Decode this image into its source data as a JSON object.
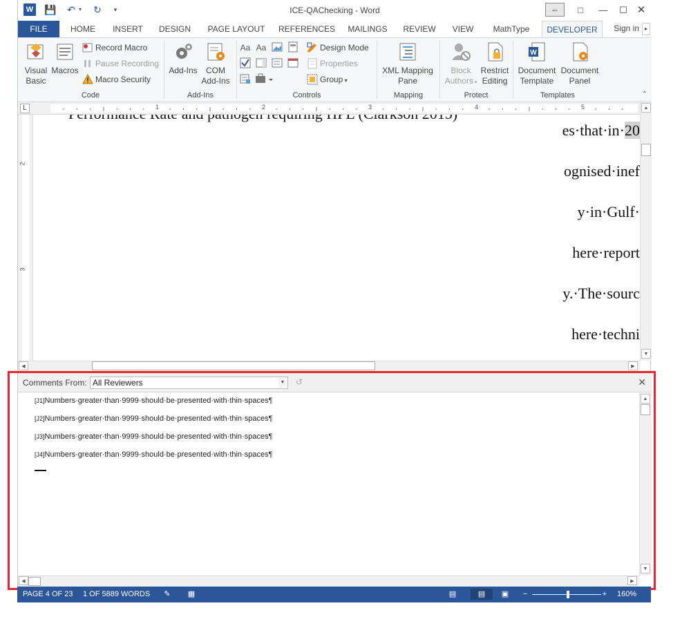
{
  "window": {
    "title": "ICE-QAChecking - Word",
    "qat": {
      "app_icon": "W"
    }
  },
  "tabs": [
    {
      "label": "FILE"
    },
    {
      "label": "HOME"
    },
    {
      "label": "INSERT"
    },
    {
      "label": "DESIGN"
    },
    {
      "label": "PAGE LAYOUT"
    },
    {
      "label": "REFERENCES"
    },
    {
      "label": "MAILINGS"
    },
    {
      "label": "REVIEW"
    },
    {
      "label": "VIEW"
    },
    {
      "label": "MathType"
    },
    {
      "label": "DEVELOPER"
    }
  ],
  "signin": "Sign in",
  "ribbon": {
    "code": {
      "label": "Code",
      "visual_basic_1": "Visual",
      "visual_basic_2": "Basic",
      "macros": "Macros",
      "record_macro": "Record Macro",
      "pause_recording": "Pause Recording",
      "macro_security": "Macro Security"
    },
    "addins": {
      "label": "Add-Ins",
      "addins": "Add-Ins",
      "com_1": "COM",
      "com_2": "Add-Ins"
    },
    "controls": {
      "label": "Controls",
      "design_mode": "Design Mode",
      "properties": "Properties",
      "group": "Group"
    },
    "mapping": {
      "label": "Mapping",
      "xml_1": "XML Mapping",
      "xml_2": "Pane"
    },
    "protect": {
      "label": "Protect",
      "block_1": "Block",
      "block_2": "Authors",
      "restrict_1": "Restrict",
      "restrict_2": "Editing"
    },
    "templates": {
      "label": "Templates",
      "doc_template_1": "Document",
      "doc_template_2": "Template",
      "doc_panel_1": "Document",
      "doc_panel_2": "Panel"
    }
  },
  "ruler": {
    "h_numbers": [
      "1",
      "2",
      "3",
      "4",
      "5"
    ],
    "v_numbers": [
      "2",
      "3"
    ],
    "tab_selector": "L"
  },
  "document": {
    "lines": [
      "es·that·in·",
      "ognised·inef",
      "y·in·Gulf·",
      "here·report",
      "y.·The·sourc",
      "here·techni"
    ],
    "line1_highlight": "20",
    "top_cut_text": "Performance Rate and pathogen requiring HPL (Clarkson 2015)"
  },
  "comments_pane": {
    "from_label": "Comments From:",
    "reviewer": "All Reviewers",
    "comments": [
      {
        "mark": "[J1]",
        "text": "Numbers·greater·than·9999·should·be·presented·with·thin·spaces¶"
      },
      {
        "mark": "[J2]",
        "text": "Numbers·greater·than·9999·should·be·presented·with·thin·spaces¶"
      },
      {
        "mark": "[J3]",
        "text": "Numbers·greater·than·9999·should·be·presented·with·thin·spaces¶"
      },
      {
        "mark": "[J4]",
        "text": "Numbers·greater·than·9999·should·be·presented·with·thin·spaces¶"
      }
    ]
  },
  "status": {
    "page": "PAGE 4 OF 23",
    "words": "1 OF 5889 WORDS",
    "zoom": "160%"
  },
  "colors": {
    "accent": "#2b579a",
    "highlight_box": "#e3262f"
  }
}
